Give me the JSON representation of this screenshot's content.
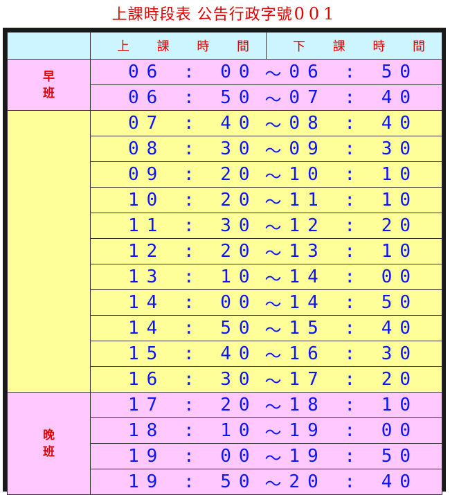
{
  "title": {
    "text": "上課時段表 公告行政字號",
    "number": "001"
  },
  "header": {
    "start_label": [
      "上",
      "課",
      "時",
      "間"
    ],
    "end_label": [
      "下",
      "課",
      "時",
      "間"
    ]
  },
  "groups": [
    {
      "label": "早班",
      "color": "#ffc8ff",
      "rows": [
        [
          "06:00",
          "06:50"
        ],
        [
          "06:50",
          "07:40"
        ]
      ]
    },
    {
      "label": "",
      "color": "#ffff99",
      "rows": [
        [
          "07:40",
          "08:40"
        ],
        [
          "08:30",
          "09:30"
        ],
        [
          "09:20",
          "10:10"
        ],
        [
          "10:20",
          "11:10"
        ],
        [
          "11:30",
          "12:20"
        ],
        [
          "12:20",
          "13:10"
        ],
        [
          "13:10",
          "14:00"
        ],
        [
          "14:00",
          "14:50"
        ],
        [
          "14:50",
          "15:40"
        ],
        [
          "15:40",
          "16:30"
        ],
        [
          "16:30",
          "17:20"
        ]
      ]
    },
    {
      "label": "晚班",
      "color": "#ffc8ff",
      "rows": [
        [
          "17:20",
          "18:10"
        ],
        [
          "18:10",
          "19:00"
        ],
        [
          "19:00",
          "19:50"
        ],
        [
          "19:50",
          "20:40"
        ]
      ]
    }
  ],
  "separator": "～"
}
